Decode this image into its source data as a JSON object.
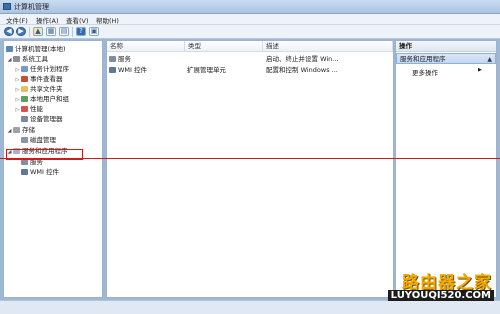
{
  "window": {
    "title": "计算机管理"
  },
  "menu": [
    "文件(F)",
    "操作(A)",
    "查看(V)",
    "帮助(H)"
  ],
  "toolbar": {
    "back_icon": "back-arrow-icon",
    "forward_icon": "forward-arrow-icon",
    "up_icon": "up-folder-icon",
    "console_icon": "console-tree-icon",
    "properties_icon": "properties-icon",
    "help_icon": "help-icon",
    "extra_icon": "show-hide-icon"
  },
  "tree": {
    "root": "计算机管理(本地)",
    "system_tools": "系统工具",
    "children": [
      "任务计划程序",
      "事件查看器",
      "共享文件夹",
      "本地用户和组",
      "性能",
      "设备管理器"
    ],
    "storage": "存储",
    "disk": "磁盘管理",
    "services_apps": "服务和应用程序",
    "services": "服务",
    "wmi": "WMI 控件"
  },
  "list": {
    "headers": [
      "名称",
      "类型",
      "描述"
    ],
    "rows": [
      {
        "name": "服务",
        "type": "",
        "desc": "启动、终止并设置 Win..."
      },
      {
        "name": "WMI 控件",
        "type": "扩展管理单元",
        "desc": "配置和控制 Windows ..."
      }
    ]
  },
  "actions": {
    "header": "操作",
    "selected": "服务和应用程序",
    "more": "更多操作"
  },
  "watermark": {
    "line1": "路由器之家",
    "line2": "LUYOUQI520.COM"
  },
  "colors": {
    "annotation_red": "#d11a1a",
    "selection_blue": "#c3d7f0"
  }
}
